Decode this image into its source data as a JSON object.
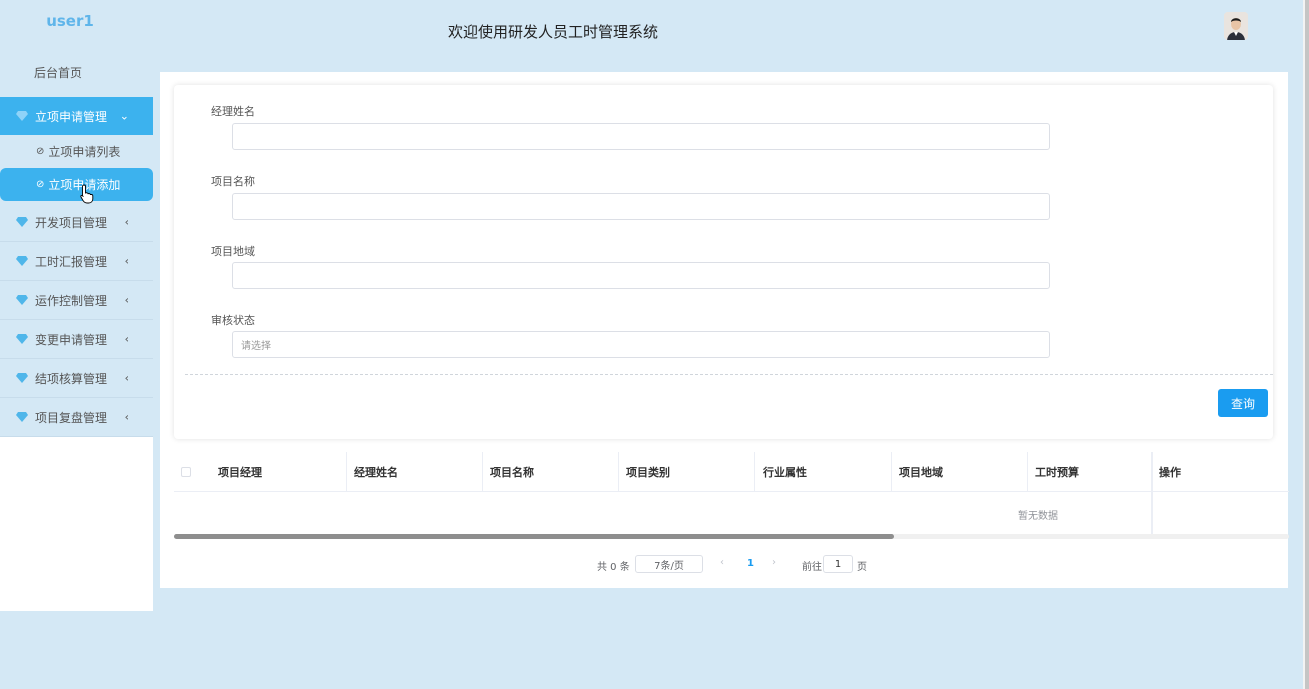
{
  "app": {
    "username": "user1",
    "header_title": "欢迎使用研发人员工时管理系统"
  },
  "sidebar": {
    "home": "后台首页",
    "menus": [
      {
        "label": "立项申请管理",
        "expanded": true,
        "sub": [
          {
            "label": "立项申请列表",
            "active": false
          },
          {
            "label": "立项申请添加",
            "active": true
          }
        ]
      },
      {
        "label": "开发项目管理",
        "expanded": false
      },
      {
        "label": "工时汇报管理",
        "expanded": false
      },
      {
        "label": "运作控制管理",
        "expanded": false
      },
      {
        "label": "变更申请管理",
        "expanded": false
      },
      {
        "label": "结项核算管理",
        "expanded": false
      },
      {
        "label": "项目复盘管理",
        "expanded": false
      }
    ]
  },
  "search": {
    "fields": [
      {
        "label": "经理姓名",
        "value": "",
        "placeholder": ""
      },
      {
        "label": "项目名称",
        "value": "",
        "placeholder": ""
      },
      {
        "label": "项目地域",
        "value": "",
        "placeholder": ""
      },
      {
        "label": "审核状态",
        "value": "",
        "placeholder": "请选择"
      }
    ],
    "query_button": "查询"
  },
  "table": {
    "columns": [
      "项目经理",
      "经理姓名",
      "项目名称",
      "项目类别",
      "行业属性",
      "项目地域",
      "工时预算",
      "操作"
    ],
    "rows": [],
    "empty_text": "暂无数据"
  },
  "pagination": {
    "total": "共 0 条",
    "page_size": "7条/页",
    "current_page": "1",
    "goto_label": "前往",
    "goto_value": "1",
    "page_suffix": "页"
  },
  "colors": {
    "accent": "#3cb2ee",
    "primary_button": "#1a9cf0",
    "background": "#d4e8f5"
  }
}
